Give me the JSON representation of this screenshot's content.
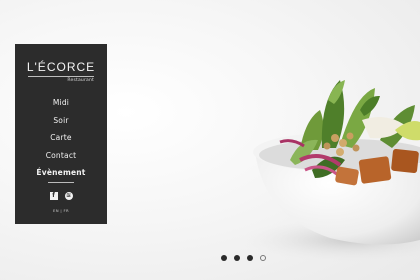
{
  "brand": {
    "logo": "L'ÉCORCE",
    "tagline": "Restaurant"
  },
  "nav": {
    "items": [
      {
        "label": "Midi"
      },
      {
        "label": "Soir"
      },
      {
        "label": "Carte"
      },
      {
        "label": "Contact"
      },
      {
        "label": "Évènement"
      }
    ],
    "active_index": 4
  },
  "social": {
    "facebook_glyph": "f",
    "spotify_glyph": "≋"
  },
  "language": {
    "en": "EN",
    "separator": "|",
    "fr": "FR"
  },
  "carousel": {
    "total_slides": 4,
    "current_slide": 4
  },
  "colors": {
    "panel": "#2c2c2c",
    "text": "#f2f2f2"
  }
}
